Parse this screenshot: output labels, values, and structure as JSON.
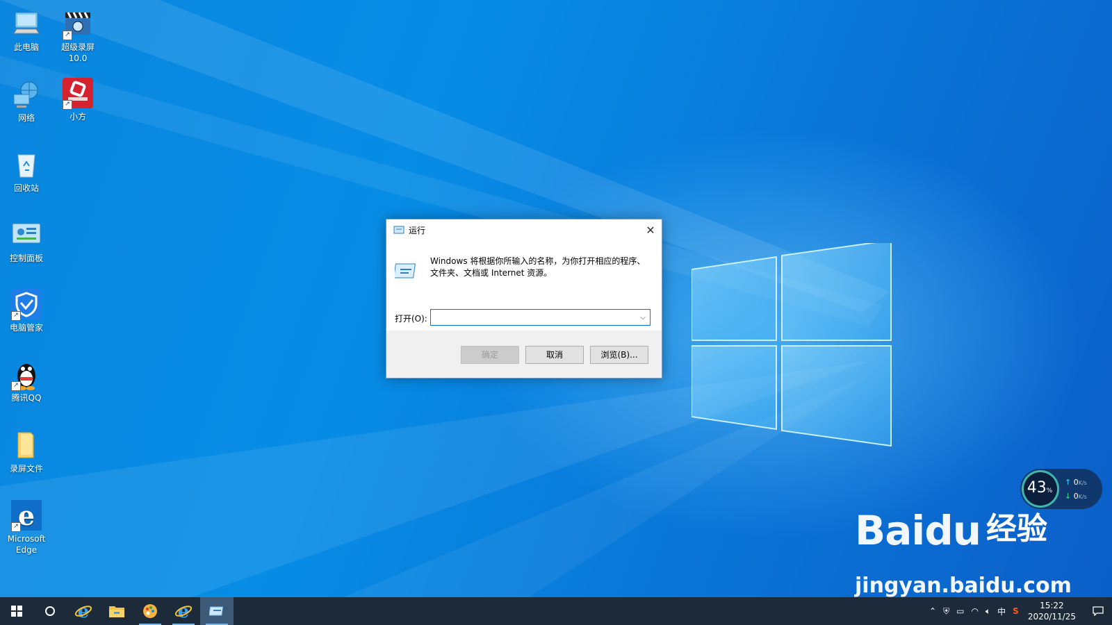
{
  "desktop": {
    "icons": [
      {
        "label": "此电脑"
      },
      {
        "label": "超级录屏\n10.0"
      },
      {
        "label": "网络"
      },
      {
        "label": "小方"
      },
      {
        "label": "回收站"
      },
      {
        "label": "控制面板"
      },
      {
        "label": "电脑管家"
      },
      {
        "label": "腾讯QQ"
      },
      {
        "label": "录屏文件"
      },
      {
        "label": "Microsoft\nEdge"
      }
    ]
  },
  "dialog": {
    "title": "运行",
    "description": "Windows 将根据你所输入的名称，为你打开相应的程序、文件夹、文档或 Internet 资源。",
    "open_label": "打开(O):",
    "open_value": "",
    "ok_label": "确定",
    "cancel_label": "取消",
    "browse_label": "浏览(B)..."
  },
  "net_widget": {
    "percent": "43",
    "percent_unit": "%",
    "upload": "0",
    "download": "0",
    "unit": "K/s"
  },
  "watermark": {
    "brand": "Baidu",
    "suffix": "经验",
    "url": "jingyan.baidu.com"
  },
  "taskbar": {
    "tray_ime": "中",
    "time": "15:22",
    "date": "2020/11/25"
  }
}
